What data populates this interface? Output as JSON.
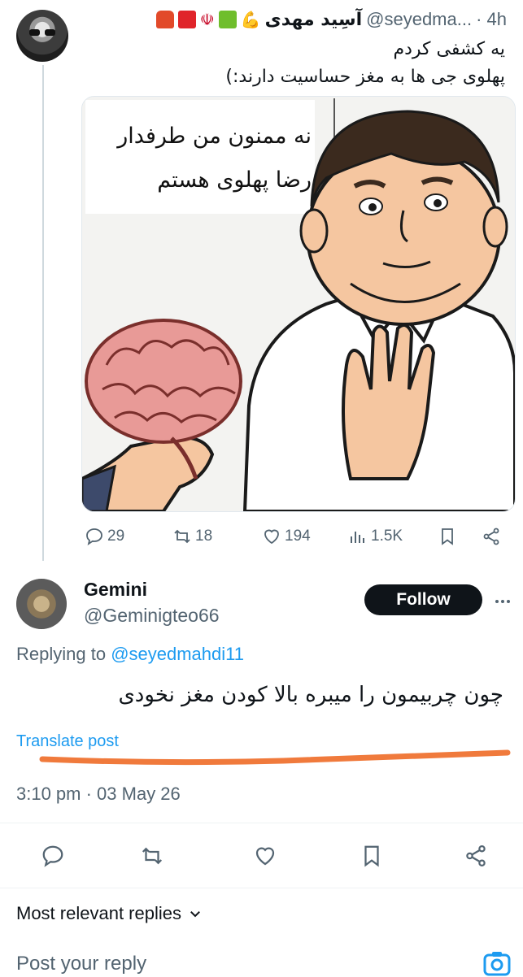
{
  "original_post": {
    "display_name": "آسِید مهدی",
    "handle": "@seyedma...",
    "time": "· 4h",
    "text_line1": "یه کشفی کردم",
    "text_line2": "پهلوی جی ها به مغز حساسیت دارند:)",
    "image": {
      "speech_line1": "نه ممنون من طرفدار",
      "speech_line2": "رضا پهلوی هستم"
    },
    "stats": {
      "replies": "29",
      "reposts": "18",
      "likes": "194",
      "views": "1.5K"
    }
  },
  "reply": {
    "display_name": "Gemini",
    "handle": "@Geminigteo66",
    "follow_label": "Follow",
    "replying_prefix": "Replying to ",
    "replying_handle": "@seyedmahdi11",
    "text": "چون چربیمون را میبره بالا کودن مغز نخودی",
    "translate_label": "Translate post",
    "timestamp": "3:10 pm · 03 May 26"
  },
  "footer": {
    "sort_label": "Most relevant replies",
    "reply_placeholder": "Post your reply"
  },
  "colors": {
    "accent": "#1d9bf0",
    "muted": "#536471",
    "underline": "#f07a3c",
    "follow_bg": "#0f1419"
  },
  "icons": [
    "reply-icon",
    "repost-icon",
    "like-icon",
    "views-icon",
    "bookmark-icon",
    "share-icon",
    "more-icon",
    "chevron-down-icon",
    "camera-icon"
  ]
}
